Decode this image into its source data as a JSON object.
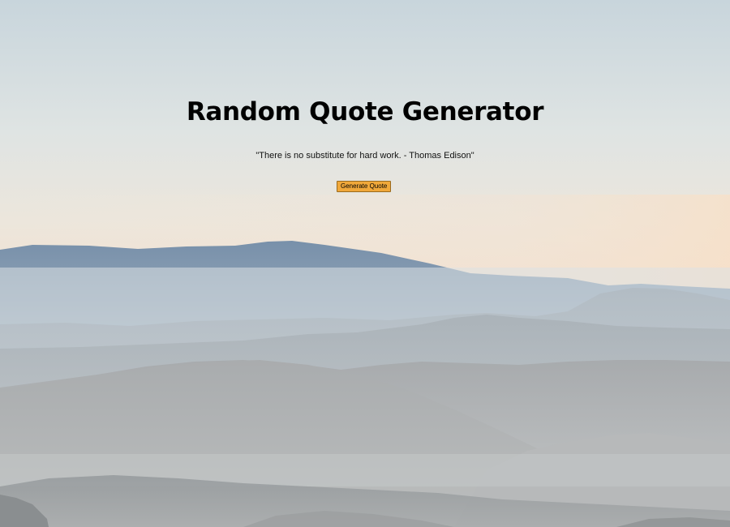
{
  "page": {
    "title": "Random Quote Generator"
  },
  "quote": {
    "text": "\"There is no substitute for hard work. - Thomas Edison\""
  },
  "actions": {
    "generate_label": "Generate Quote"
  },
  "colors": {
    "button_bg": "#f0a83a",
    "sky_top": "#c9d6dd",
    "sky_glow": "#efe4d6",
    "ridge_blue": "#7e95ad",
    "haze": "#c9cfd2"
  },
  "icons": {
    "background": "mountain-landscape-icon"
  }
}
